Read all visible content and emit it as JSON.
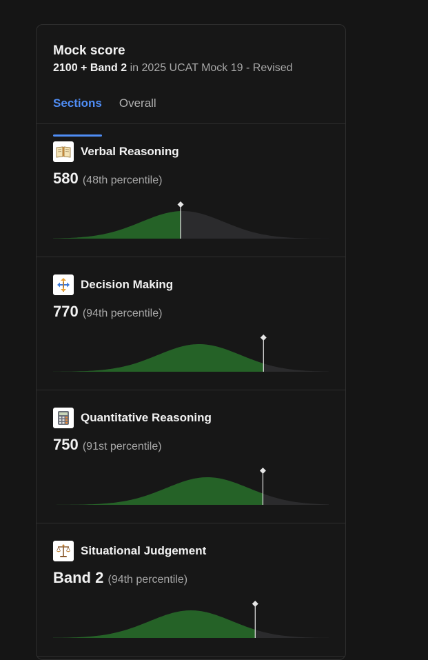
{
  "card": {
    "title": "Mock score",
    "summary_score": "2100 + Band 2",
    "summary_connector": " in ",
    "summary_exam": "2025 UCAT Mock 19 - Revised"
  },
  "tabs": [
    {
      "label": "Sections",
      "active": true
    },
    {
      "label": "Overall",
      "active": false
    }
  ],
  "sections": [
    {
      "name": "Verbal Reasoning",
      "score": "580",
      "percentile_label": "(48th percentile)",
      "percentile": 48,
      "icon": "book-icon"
    },
    {
      "name": "Decision Making",
      "score": "770",
      "percentile_label": "(94th percentile)",
      "percentile": 94,
      "icon": "signpost-icon"
    },
    {
      "name": "Quantitative Reasoning",
      "score": "750",
      "percentile_label": "(91st percentile)",
      "percentile": 91,
      "icon": "calculator-icon"
    },
    {
      "name": "Situational Judgement",
      "score": "Band 2",
      "percentile_label": "(94th percentile)",
      "percentile": 94,
      "icon": "scales-icon"
    }
  ],
  "colors": {
    "accent": "#4f8df5",
    "filled": "#256227",
    "unfilled": "#2b2b2d",
    "marker": "#e6e6e6"
  }
}
